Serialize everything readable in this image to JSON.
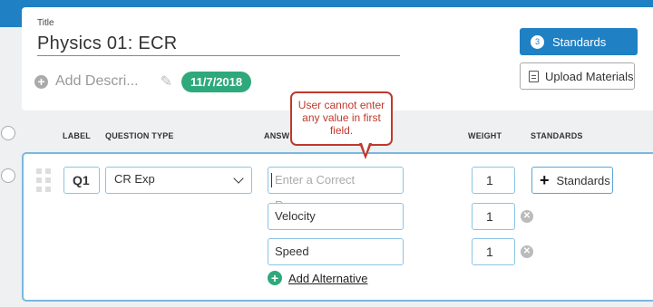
{
  "header": {
    "title_label": "Title",
    "title_value": "Physics 01: ECR",
    "add_description": "Add Descri...",
    "date_badge": "11/7/2018",
    "standards_count": "3",
    "standards_button": "Standards",
    "upload_button": "Upload Materials"
  },
  "columns": {
    "label": "LABEL",
    "question_type": "QUESTION TYPE",
    "answer": "ANSW",
    "weight": "WEIGHT",
    "standards": "STANDARDS"
  },
  "question": {
    "label": "Q1",
    "type": "CR Exp",
    "answers": [
      {
        "value": "",
        "placeholder": "Enter a Correct Response",
        "weight": "1"
      },
      {
        "value": "Velocity",
        "weight": "1"
      },
      {
        "value": "Speed",
        "weight": "1"
      }
    ],
    "standards_button": "Standards",
    "add_alternative": "Add Alternative"
  },
  "callout": {
    "text": "User cannot enter any value in first field."
  },
  "colors": {
    "brand_blue": "#1f80c4",
    "green": "#2ea97c",
    "annotation_red": "#c0392b"
  }
}
